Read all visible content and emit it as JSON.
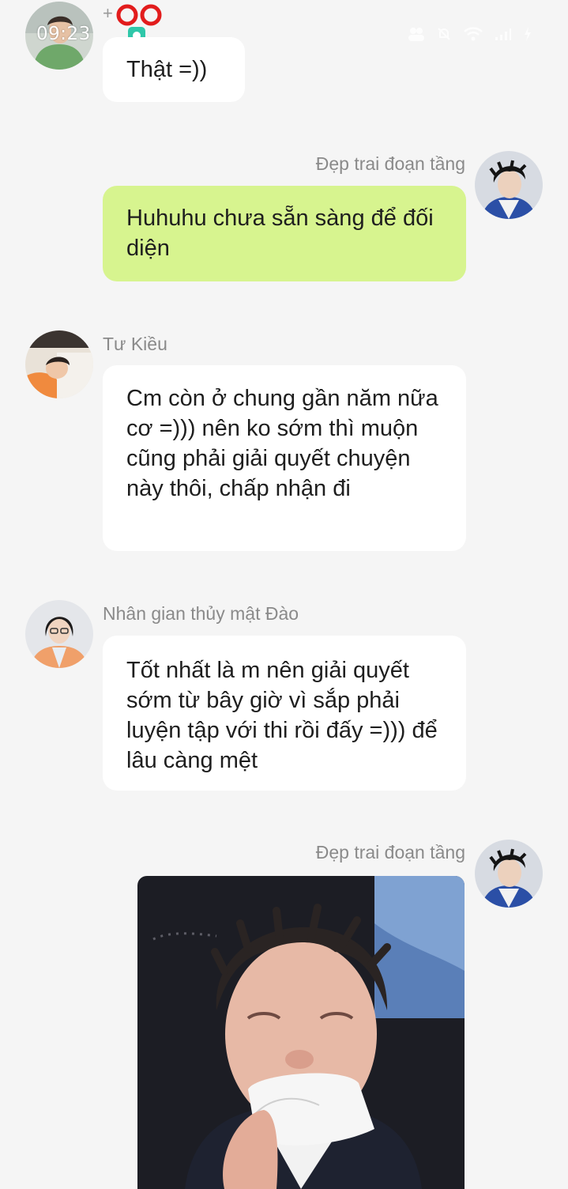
{
  "status_bar": {
    "time": "09:23",
    "icons": [
      "people-icon",
      "mute-icon",
      "wifi-icon",
      "signal-icon",
      "battery-icon"
    ]
  },
  "header": {
    "plus_sign": "+"
  },
  "messages": [
    {
      "sender": "",
      "side": "left",
      "text": "Thật =))",
      "bubble_color": "#ffffff"
    },
    {
      "sender": "Đẹp trai đoạn tầng",
      "side": "right",
      "text": "Huhuhu chưa sẵn sàng để đối diện",
      "bubble_color": "#d7f48f"
    },
    {
      "sender": "Tư Kiều",
      "side": "left",
      "text": "Cm còn ở chung gần năm nữa cơ =))) nên ko sớm thì muộn cũng phải giải quyết chuyện này thôi, chấp nhận đi",
      "bubble_color": "#ffffff"
    },
    {
      "sender": "Nhân gian thủy mật Đào",
      "side": "left",
      "text": "Tốt nhất là m nên giải quyết sớm từ bây giờ vì sắp phải luyện tập với thi rồi đấy =))) để lâu càng mệt",
      "bubble_color": "#ffffff"
    },
    {
      "sender": "Đẹp trai đoạn tầng",
      "side": "right",
      "text": "",
      "image": "photo of a crying young man wiping his nose with a tissue"
    }
  ],
  "colors": {
    "background": "#f5f5f5",
    "own_bubble": "#d7f48f",
    "other_bubble": "#ffffff",
    "sender_name": "#8a8a8a"
  }
}
